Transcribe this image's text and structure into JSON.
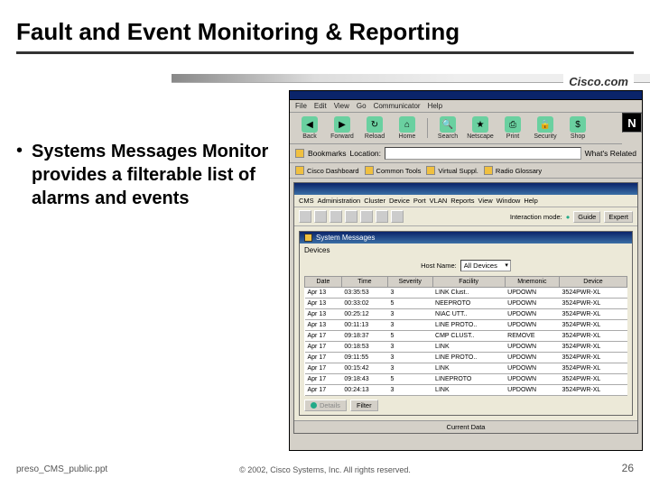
{
  "slide": {
    "title": "Fault and Event Monitoring & Reporting",
    "bullet": "Systems Messages Monitor provides a filterable list of alarms and events",
    "footer_left": "preso_CMS_public.ppt",
    "footer_mid": "© 2002, Cisco Systems, Inc. All rights reserved.",
    "footer_right": "26",
    "logo": "Cisco.com"
  },
  "browser": {
    "menus": [
      "File",
      "Edit",
      "View",
      "Go",
      "Communicator",
      "Help"
    ],
    "toolbar": [
      {
        "label": "Back",
        "ico": "◀",
        "bg": "#6ad0a0"
      },
      {
        "label": "Forward",
        "ico": "▶",
        "bg": "#6ad0a0"
      },
      {
        "label": "Reload",
        "ico": "↻",
        "bg": "#6ad0a0"
      },
      {
        "label": "Home",
        "ico": "⌂",
        "bg": "#6ad0a0"
      },
      {
        "label": "Search",
        "ico": "🔍",
        "bg": "#6ad0a0"
      },
      {
        "label": "Netscape",
        "ico": "★",
        "bg": "#6ad0a0"
      },
      {
        "label": "Print",
        "ico": "⎙",
        "bg": "#6ad0a0"
      },
      {
        "label": "Security",
        "ico": "🔒",
        "bg": "#6ad0a0"
      },
      {
        "label": "Shop",
        "ico": "$",
        "bg": "#6ad0a0"
      }
    ],
    "addr_left": [
      "Bookmarks",
      "Location:"
    ],
    "addr_value": "",
    "addr_right": "What's Related",
    "tabs": [
      "Cisco Dashboard",
      "Common Tools",
      "Virtual Suppl.",
      "Radio Glossary"
    ],
    "n_logo": "N"
  },
  "cms": {
    "menus": [
      "CMS",
      "Administration",
      "Cluster",
      "Device",
      "Port",
      "VLAN",
      "Reports",
      "View",
      "Window",
      "Help"
    ],
    "mode_label": "Interaction mode:",
    "mode_guide": "Guide",
    "mode_expert": "Expert",
    "status": "Current Data"
  },
  "sysmsg": {
    "title": "System Messages",
    "devices_label": "Devices",
    "hostname_label": "Host Name:",
    "hostname_value": "All Devices",
    "headers": [
      "Date",
      "Time",
      "Severity",
      "Facility",
      "Mnemonic",
      "Device"
    ],
    "rows": [
      [
        "Apr 13",
        "03:35:53",
        "3",
        "LINK Clust..",
        "UPDOWN",
        "3524PWR-XL"
      ],
      [
        "Apr 13",
        "00:33:02",
        "5",
        "NEEPROTO",
        "UPDOWN",
        "3524PWR-XL"
      ],
      [
        "Apr 13",
        "00:25:12",
        "3",
        "NIAC UTT..",
        "UPDOWN",
        "3524PWR-XL"
      ],
      [
        "Apr 13",
        "00:11:13",
        "3",
        "LINE PROTO..",
        "UPDOWN",
        "3524PWR-XL"
      ],
      [
        "Apr 17",
        "09:18:37",
        "5",
        "CMP CLUST..",
        "REMOVE",
        "3524PWR-XL"
      ],
      [
        "Apr 17",
        "00:18:53",
        "3",
        "LINK",
        "UPDOWN",
        "3524PWR-XL"
      ],
      [
        "Apr 17",
        "09:11:55",
        "3",
        "LINE PROTO..",
        "UPDOWN",
        "3524PWR-XL"
      ],
      [
        "Apr 17",
        "00:15:42",
        "3",
        "LINK",
        "UPDOWN",
        "3524PWR-XL"
      ],
      [
        "Apr 17",
        "09:18:43",
        "5",
        "LINEPROTO",
        "UPDOWN",
        "3524PWR-XL"
      ],
      [
        "Apr 17",
        "00:24:13",
        "3",
        "LINK",
        "UPDOWN",
        "3524PWR-XL"
      ]
    ],
    "btn_details": "Details",
    "btn_filter": "Filter"
  }
}
